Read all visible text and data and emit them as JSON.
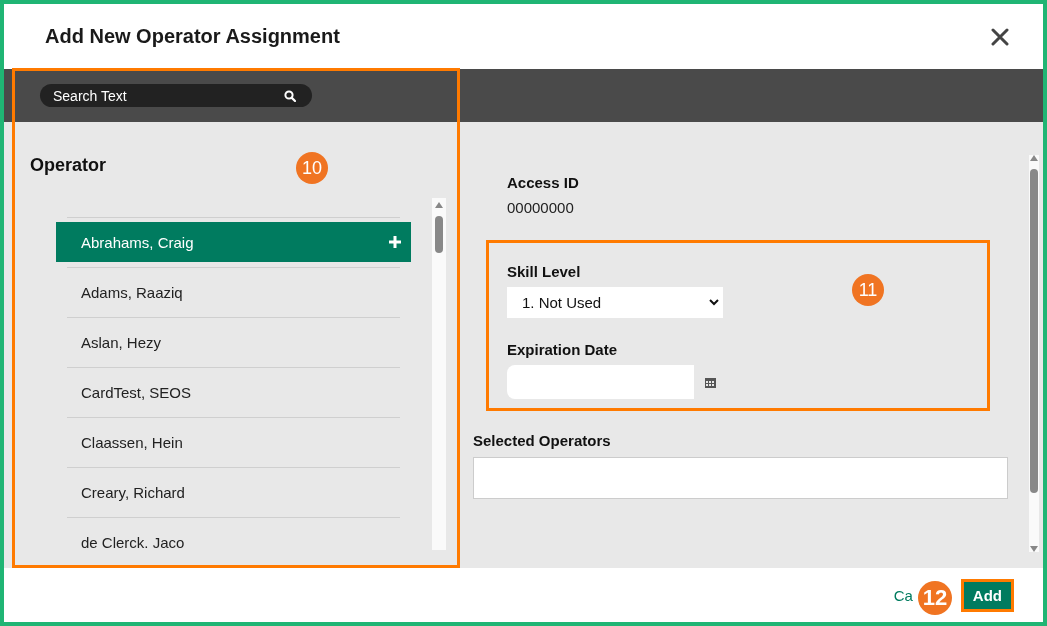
{
  "window": {
    "title": "Add New Operator Assignment"
  },
  "toolbar": {
    "search": {
      "placeholder": "Search Text"
    }
  },
  "operator_panel": {
    "heading": "Operator",
    "operators": [
      {
        "name": "Abrahams, Craig",
        "selected": true
      },
      {
        "name": "Adams, Raaziq",
        "selected": false
      },
      {
        "name": "Aslan, Hezy",
        "selected": false
      },
      {
        "name": "CardTest, SEOS",
        "selected": false
      },
      {
        "name": "Claassen, Hein",
        "selected": false
      },
      {
        "name": "Creary, Richard",
        "selected": false
      },
      {
        "name": "de Clerck. Jaco",
        "selected": false
      }
    ]
  },
  "details": {
    "access_id_label": "Access ID",
    "access_id_value": "00000000",
    "skill_level_label": "Skill Level",
    "skill_level_value": "1. Not Used",
    "expiration_date_label": "Expiration Date",
    "selected_operators_label": "Selected Operators"
  },
  "footer": {
    "cancel": "Ca",
    "add": "Add"
  },
  "callouts": [
    {
      "number": "10"
    },
    {
      "number": "11"
    },
    {
      "number": "12"
    }
  ]
}
